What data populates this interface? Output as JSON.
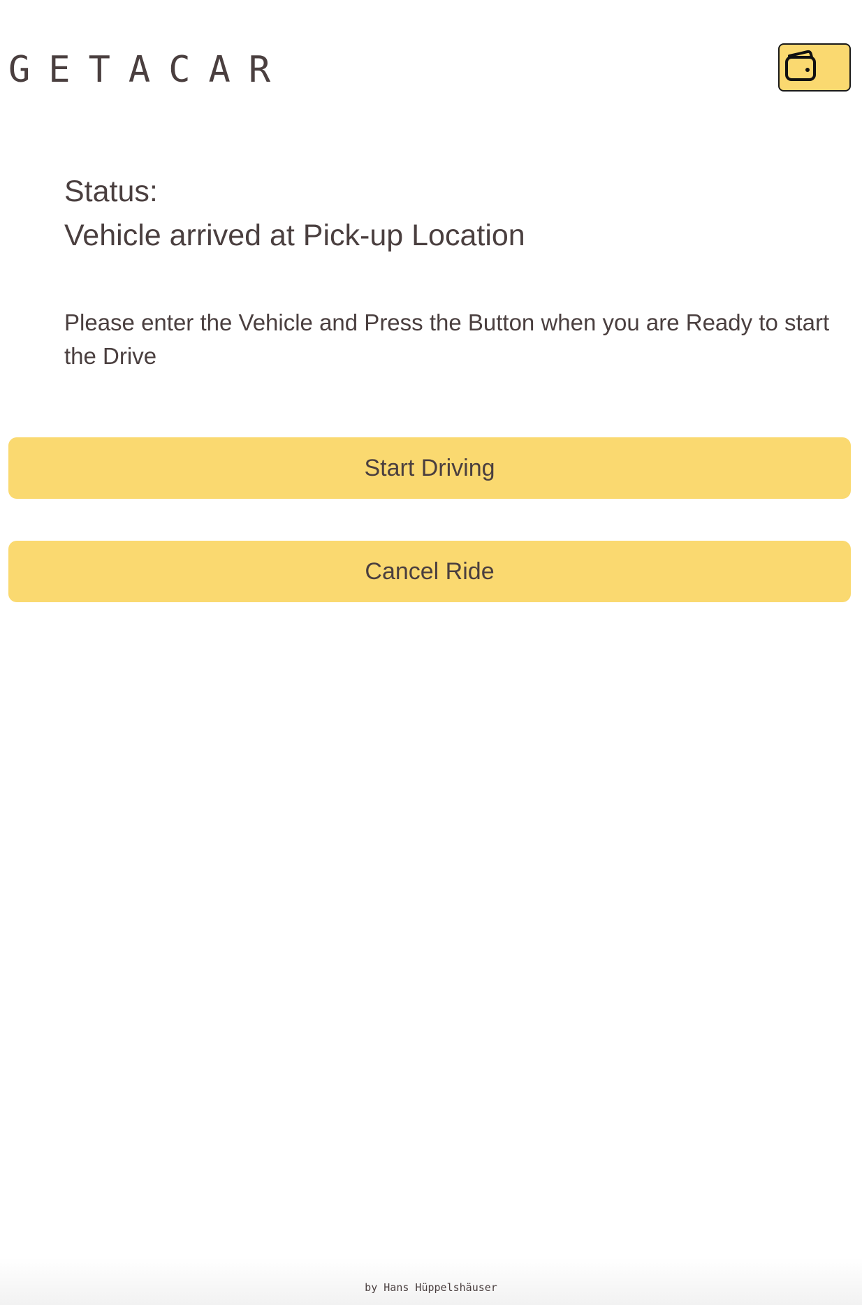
{
  "header": {
    "logo_text": "GETACAR",
    "wallet_button_icon": "wallet-icon"
  },
  "status": {
    "label": "Status:",
    "value": "Vehicle arrived at Pick-up Location"
  },
  "instructions": {
    "text": "Please enter the Vehicle and Press the Button when you are Ready to start the Drive"
  },
  "actions": {
    "start_label": "Start Driving",
    "cancel_label": "Cancel Ride"
  },
  "footer": {
    "credit": "by Hans Hüppelshäuser"
  },
  "colors": {
    "accent": "#fad970",
    "text": "#4a3f3f",
    "background": "#ffffff"
  }
}
